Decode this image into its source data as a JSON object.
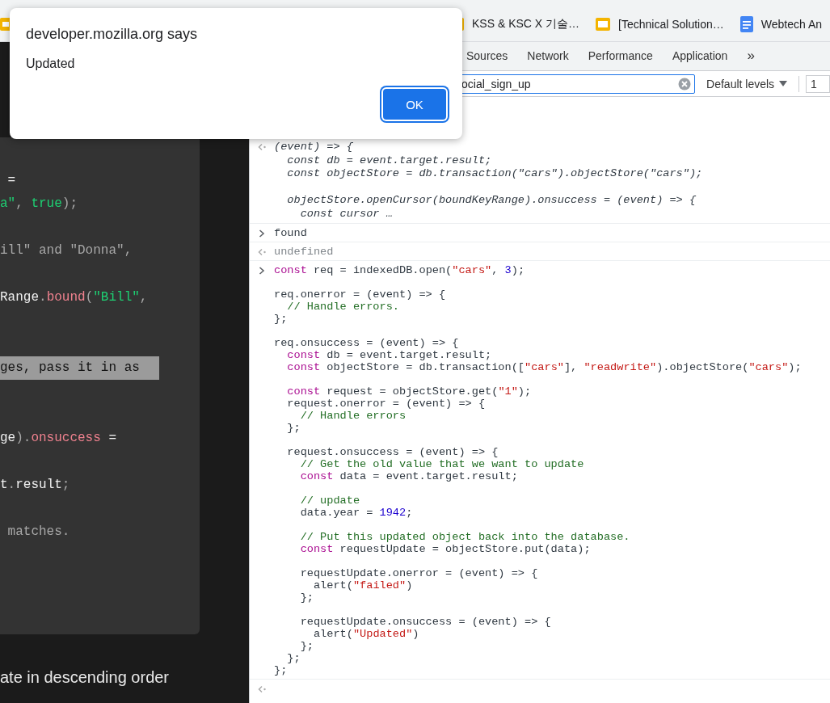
{
  "bookmarks": [
    {
      "kind": "slides",
      "label": "KSS & KSC X 기술…"
    },
    {
      "kind": "slides",
      "label": "[Technical Solution…"
    },
    {
      "kind": "docs",
      "label": "Webtech An"
    }
  ],
  "page": {
    "code_lines": [
      {
        "kind": "code",
        "segs": [
          {
            "t": " =",
            "kind": "plain"
          }
        ]
      },
      {
        "kind": "code",
        "segs": [
          {
            "t": "a\"",
            "kind": "str"
          },
          {
            "t": ", ",
            "kind": "punc"
          },
          {
            "t": "true",
            "kind": "str"
          },
          {
            "t": ");",
            "kind": "punc"
          }
        ]
      },
      {
        "kind": "blank"
      },
      {
        "kind": "code",
        "segs": [
          {
            "t": "ill\" and \"Donna\",",
            "kind": "com"
          }
        ]
      },
      {
        "kind": "blank"
      },
      {
        "kind": "code",
        "segs": [
          {
            "t": "Range",
            "kind": "plain"
          },
          {
            "t": ".",
            "kind": "punc"
          },
          {
            "t": "bound",
            "kind": "fn"
          },
          {
            "t": "(",
            "kind": "punc"
          },
          {
            "t": "\"Bill\"",
            "kind": "str"
          },
          {
            "t": ",",
            "kind": "punc"
          }
        ]
      },
      {
        "kind": "blank"
      },
      {
        "kind": "blank"
      },
      {
        "kind": "highlight",
        "segs": [
          {
            "t": "ges, pass it in as",
            "kind": "plain"
          }
        ]
      },
      {
        "kind": "blank"
      },
      {
        "kind": "blank"
      },
      {
        "kind": "code",
        "segs": [
          {
            "t": "ge",
            "kind": "plain"
          },
          {
            "t": ").",
            "kind": "punc"
          },
          {
            "t": "onsuccess",
            "kind": "fn"
          },
          {
            "t": " =",
            "kind": "plain"
          }
        ]
      },
      {
        "kind": "blank"
      },
      {
        "kind": "code",
        "segs": [
          {
            "t": "t",
            "kind": "plain"
          },
          {
            "t": ".",
            "kind": "punc"
          },
          {
            "t": "result",
            "kind": "plain"
          },
          {
            "t": ";",
            "kind": "punc"
          }
        ]
      },
      {
        "kind": "blank"
      },
      {
        "kind": "code",
        "segs": [
          {
            "t": " matches.",
            "kind": "com"
          }
        ]
      }
    ],
    "text": "ate in descending order"
  },
  "devtools": {
    "tabs": [
      {
        "label": "Sources",
        "selected": false
      },
      {
        "label": "Network",
        "selected": false
      },
      {
        "label": "Performance",
        "selected": false
      },
      {
        "label": "Application",
        "selected": false
      }
    ],
    "more_tabs": "»",
    "filter": {
      "value": "ocial_sign_up"
    },
    "levels": "Default levels",
    "box_value": "1",
    "console": [
      {
        "kind": "preview",
        "lines": [
          {
            "kind": "code",
            "segs": [
              {
                "t": "(event) => {",
                "kind": "plain"
              }
            ]
          },
          {
            "kind": "code",
            "segs": [
              {
                "t": "  const db = event.target.result;",
                "kind": "plain"
              }
            ]
          },
          {
            "kind": "code",
            "segs": [
              {
                "t": "  const objectStore = db.transaction(\"cars\").objectStore(\"cars\");",
                "kind": "plain"
              }
            ]
          },
          {
            "kind": "blank"
          },
          {
            "kind": "code",
            "segs": [
              {
                "t": "  objectStore.openCursor(boundKeyRange).onsuccess = (event) => {",
                "kind": "plain"
              }
            ]
          },
          {
            "kind": "code",
            "segs": [
              {
                "t": "    const cursor …",
                "kind": "plain"
              }
            ]
          }
        ]
      },
      {
        "kind": "input",
        "lines": [
          {
            "kind": "code",
            "segs": [
              {
                "t": "found",
                "kind": "plain"
              }
            ]
          }
        ]
      },
      {
        "kind": "value",
        "lines": [
          {
            "kind": "code",
            "segs": [
              {
                "t": "undefined",
                "kind": "plain"
              }
            ]
          }
        ]
      },
      {
        "kind": "input",
        "lines": [
          {
            "kind": "code",
            "segs": [
              {
                "t": "const",
                "kind": "kw"
              },
              {
                "t": " req = indexedDB.open(",
                "kind": "plain"
              },
              {
                "t": "\"cars\"",
                "kind": "str"
              },
              {
                "t": ", ",
                "kind": "plain"
              },
              {
                "t": "3",
                "kind": "num"
              },
              {
                "t": ");",
                "kind": "plain"
              }
            ]
          },
          {
            "kind": "blank"
          },
          {
            "kind": "code",
            "segs": [
              {
                "t": "req.onerror = (event) => {",
                "kind": "plain"
              }
            ]
          },
          {
            "kind": "code",
            "segs": [
              {
                "t": "  // Handle errors.",
                "kind": "com"
              }
            ]
          },
          {
            "kind": "code",
            "segs": [
              {
                "t": "};",
                "kind": "plain"
              }
            ]
          },
          {
            "kind": "blank"
          },
          {
            "kind": "code",
            "segs": [
              {
                "t": "req.onsuccess = (event) => {",
                "kind": "plain"
              }
            ]
          },
          {
            "kind": "code",
            "segs": [
              {
                "t": "  const",
                "kind": "kw"
              },
              {
                "t": " db = event.target.result;",
                "kind": "plain"
              }
            ]
          },
          {
            "kind": "code",
            "segs": [
              {
                "t": "  const",
                "kind": "kw"
              },
              {
                "t": " objectStore = db.transaction([",
                "kind": "plain"
              },
              {
                "t": "\"cars\"",
                "kind": "str"
              },
              {
                "t": "], ",
                "kind": "plain"
              },
              {
                "t": "\"readwrite\"",
                "kind": "str"
              },
              {
                "t": ").objectStore(",
                "kind": "plain"
              },
              {
                "t": "\"cars\"",
                "kind": "str"
              },
              {
                "t": ");",
                "kind": "plain"
              }
            ]
          },
          {
            "kind": "blank"
          },
          {
            "kind": "code",
            "segs": [
              {
                "t": "  const",
                "kind": "kw"
              },
              {
                "t": " request = objectStore.get(",
                "kind": "plain"
              },
              {
                "t": "\"1\"",
                "kind": "str"
              },
              {
                "t": ");",
                "kind": "plain"
              }
            ]
          },
          {
            "kind": "code",
            "segs": [
              {
                "t": "  request.onerror = (event) => {",
                "kind": "plain"
              }
            ]
          },
          {
            "kind": "code",
            "segs": [
              {
                "t": "    // Handle errors",
                "kind": "com"
              }
            ]
          },
          {
            "kind": "code",
            "segs": [
              {
                "t": "  };",
                "kind": "plain"
              }
            ]
          },
          {
            "kind": "blank"
          },
          {
            "kind": "code",
            "segs": [
              {
                "t": "  request.onsuccess = (event) => {",
                "kind": "plain"
              }
            ]
          },
          {
            "kind": "code",
            "segs": [
              {
                "t": "    // Get the old value that we want to update",
                "kind": "com"
              }
            ]
          },
          {
            "kind": "code",
            "segs": [
              {
                "t": "    const",
                "kind": "kw"
              },
              {
                "t": " data = event.target.result;",
                "kind": "plain"
              }
            ]
          },
          {
            "kind": "blank"
          },
          {
            "kind": "code",
            "segs": [
              {
                "t": "    // update",
                "kind": "com"
              }
            ]
          },
          {
            "kind": "code",
            "segs": [
              {
                "t": "    data.year = ",
                "kind": "plain"
              },
              {
                "t": "1942",
                "kind": "num"
              },
              {
                "t": ";",
                "kind": "plain"
              }
            ]
          },
          {
            "kind": "blank"
          },
          {
            "kind": "code",
            "segs": [
              {
                "t": "    // Put this updated object back into the database.",
                "kind": "com"
              }
            ]
          },
          {
            "kind": "code",
            "segs": [
              {
                "t": "    const",
                "kind": "kw"
              },
              {
                "t": " requestUpdate = objectStore.put(data);",
                "kind": "plain"
              }
            ]
          },
          {
            "kind": "blank"
          },
          {
            "kind": "code",
            "segs": [
              {
                "t": "    requestUpdate.onerror = (event) => {",
                "kind": "plain"
              }
            ]
          },
          {
            "kind": "code",
            "segs": [
              {
                "t": "      alert(",
                "kind": "plain"
              },
              {
                "t": "\"failed\"",
                "kind": "str"
              },
              {
                "t": ")",
                "kind": "plain"
              }
            ]
          },
          {
            "kind": "code",
            "segs": [
              {
                "t": "    };",
                "kind": "plain"
              }
            ]
          },
          {
            "kind": "blank"
          },
          {
            "kind": "code",
            "segs": [
              {
                "t": "    requestUpdate.onsuccess = (event) => {",
                "kind": "plain"
              }
            ]
          },
          {
            "kind": "code",
            "segs": [
              {
                "t": "      alert(",
                "kind": "plain"
              },
              {
                "t": "\"Updated\"",
                "kind": "str"
              },
              {
                "t": ")",
                "kind": "plain"
              }
            ]
          },
          {
            "kind": "code",
            "segs": [
              {
                "t": "    };",
                "kind": "plain"
              }
            ]
          },
          {
            "kind": "code",
            "segs": [
              {
                "t": "  };",
                "kind": "plain"
              }
            ]
          },
          {
            "kind": "code",
            "segs": [
              {
                "t": "};",
                "kind": "plain"
              }
            ]
          }
        ]
      },
      {
        "kind": "prompt"
      }
    ]
  },
  "dialog": {
    "title": "developer.mozilla.org says",
    "message": "Updated",
    "buttons": [
      {
        "label": "OK",
        "focused": true
      }
    ]
  }
}
